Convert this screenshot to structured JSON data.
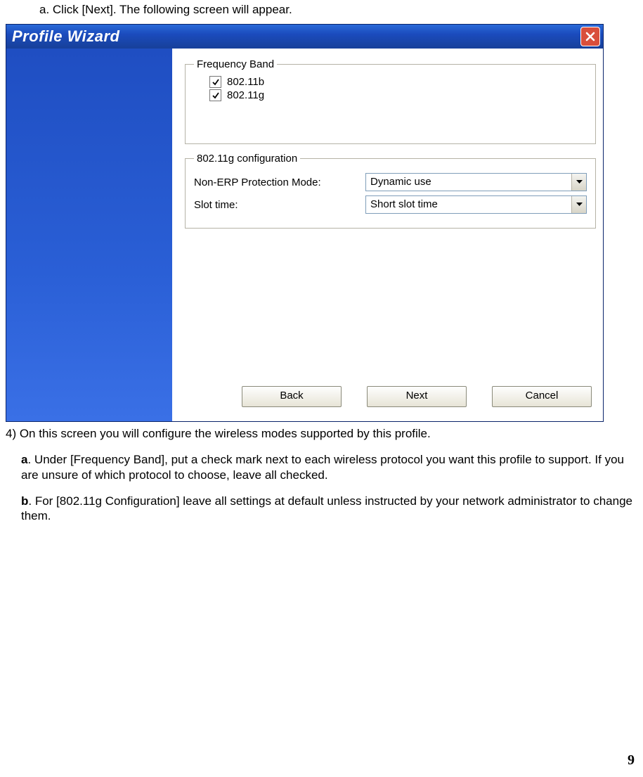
{
  "instruction_top": "a. Click [Next]. The following screen will appear.",
  "wizard": {
    "title": "Profile Wizard",
    "groups": {
      "frequency": {
        "legend": "Frequency Band",
        "options": [
          {
            "label": "802.11b",
            "checked": true
          },
          {
            "label": "802.11g",
            "checked": true
          }
        ]
      },
      "config": {
        "legend": "802.11g configuration",
        "rows": [
          {
            "label": "Non-ERP Protection Mode:",
            "value": "Dynamic use"
          },
          {
            "label": "Slot time:",
            "value": "Short slot time"
          }
        ]
      }
    },
    "buttons": {
      "back": "Back",
      "next": "Next",
      "cancel": "Cancel"
    }
  },
  "body": {
    "p1": "4) On this screen you will configure the wireless modes supported by this profile.",
    "p2_bold": "a",
    "p2_rest": ". Under [Frequency Band], put a check mark next to each wireless protocol you want this profile to support. If you are unsure of which protocol to choose, leave all checked.",
    "p3_bold": "b",
    "p3_rest": ". For [802.11g Configuration] leave all settings at default unless instructed by your network administrator to change them."
  },
  "page_number": "9"
}
